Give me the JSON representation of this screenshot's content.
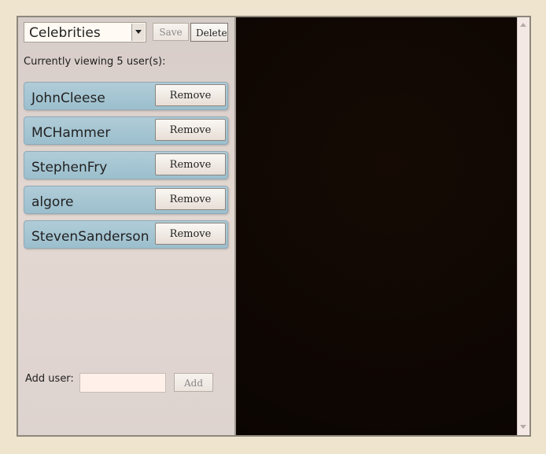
{
  "toolbar": {
    "selected_list": "Celebrities",
    "save_label": "Save",
    "delete_label": "Delete"
  },
  "summary": {
    "viewing_text": "Currently viewing 5 user(s):"
  },
  "users": [
    {
      "name": "JohnCleese",
      "remove_label": "Remove"
    },
    {
      "name": "MCHammer",
      "remove_label": "Remove"
    },
    {
      "name": "StephenFry",
      "remove_label": "Remove"
    },
    {
      "name": "algore",
      "remove_label": "Remove"
    },
    {
      "name": "StevenSanderson",
      "remove_label": "Remove"
    }
  ],
  "add_user": {
    "label": "Add user:",
    "input_value": "",
    "add_label": "Add"
  },
  "colors": {
    "page_background": "#efe5cf",
    "user_item": "#9cbfcd",
    "content_panel": "#100703"
  },
  "icons": {
    "dropdown": "chevron-down-icon",
    "scroll_up": "scroll-up-icon",
    "scroll_down": "scroll-down-icon"
  }
}
